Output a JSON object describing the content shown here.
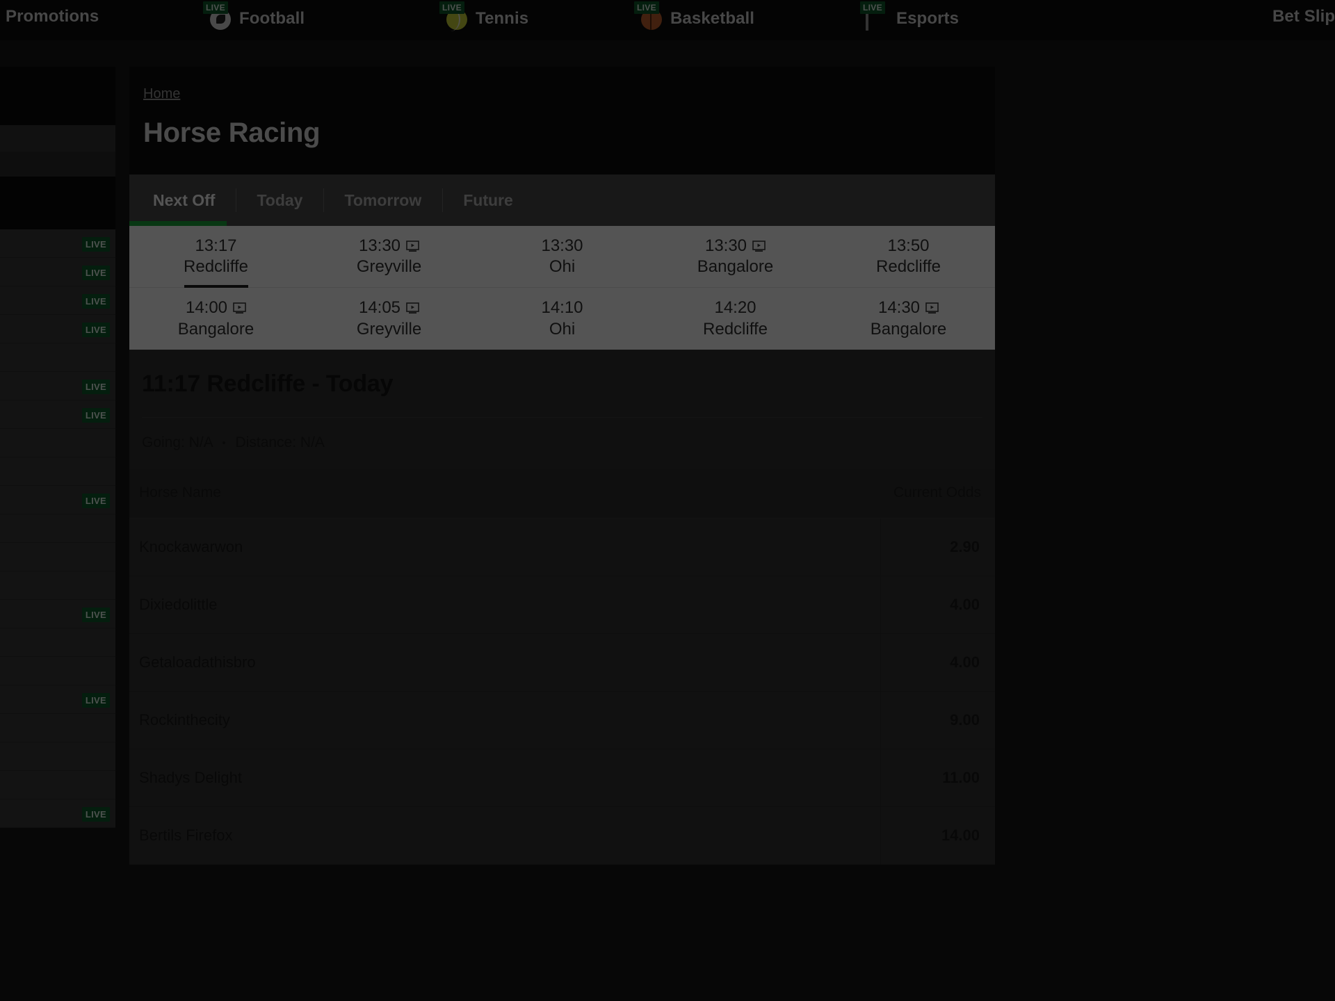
{
  "topnav": {
    "items": [
      {
        "label": "Promotions",
        "icon": "",
        "live": false
      },
      {
        "label": "Football",
        "icon": "football-icon",
        "live": true,
        "live_label": "LIVE"
      },
      {
        "label": "Tennis",
        "icon": "tennis-icon",
        "live": true,
        "live_label": "LIVE"
      },
      {
        "label": "Basketball",
        "icon": "basketball-icon",
        "live": true,
        "live_label": "LIVE"
      },
      {
        "label": "Esports",
        "icon": "esports-icon",
        "live": true,
        "live_label": "LIVE"
      },
      {
        "label": "Bet Slip",
        "icon": "",
        "live": false
      }
    ]
  },
  "sidebar": {
    "live_label": "LIVE",
    "rows": [
      {
        "live": true
      },
      {
        "live": true
      },
      {
        "live": true
      },
      {
        "live": true
      },
      {
        "live": false
      },
      {
        "live": true
      },
      {
        "live": true
      },
      {
        "live": false
      },
      {
        "live": false
      },
      {
        "live": true
      },
      {
        "live": false
      },
      {
        "live": false
      },
      {
        "live": false
      },
      {
        "live": true
      },
      {
        "live": false
      },
      {
        "live": false
      },
      {
        "live": true
      },
      {
        "live": false
      },
      {
        "live": false
      },
      {
        "live": false
      },
      {
        "live": true
      }
    ]
  },
  "header": {
    "breadcrumb": "Home",
    "title": "Horse Racing"
  },
  "tabs": {
    "items": [
      {
        "label": "Next Off",
        "active": true
      },
      {
        "label": "Today",
        "active": false
      },
      {
        "label": "Tomorrow",
        "active": false
      },
      {
        "label": "Future",
        "active": false
      }
    ]
  },
  "races": {
    "rows": [
      [
        {
          "time": "13:17",
          "venue": "Redcliffe",
          "stream": false,
          "selected": true
        },
        {
          "time": "13:30",
          "venue": "Greyville",
          "stream": true,
          "selected": false
        },
        {
          "time": "13:30",
          "venue": "Ohi",
          "stream": false,
          "selected": false
        },
        {
          "time": "13:30",
          "venue": "Bangalore",
          "stream": true,
          "selected": false
        },
        {
          "time": "13:50",
          "venue": "Redcliffe",
          "stream": false,
          "selected": false
        }
      ],
      [
        {
          "time": "14:00",
          "venue": "Bangalore",
          "stream": true,
          "selected": false
        },
        {
          "time": "14:05",
          "venue": "Greyville",
          "stream": true,
          "selected": false
        },
        {
          "time": "14:10",
          "venue": "Ohi",
          "stream": false,
          "selected": false
        },
        {
          "time": "14:20",
          "venue": "Redcliffe",
          "stream": false,
          "selected": false
        },
        {
          "time": "14:30",
          "venue": "Bangalore",
          "stream": true,
          "selected": false
        }
      ]
    ]
  },
  "race_detail": {
    "title": "11:17 Redcliffe - Today",
    "going_label": "Going:",
    "going_value": "N/A",
    "separator": "•",
    "distance_label": "Distance:",
    "distance_value": "N/A"
  },
  "runners_table": {
    "columns": {
      "name": "Horse Name",
      "odds": "Current Odds"
    },
    "rows": [
      {
        "name": "Knockawarwon",
        "odds": "2.90"
      },
      {
        "name": "Dixiedolittle",
        "odds": "4.00"
      },
      {
        "name": "Getaloadathisbro",
        "odds": "4.00"
      },
      {
        "name": "Rockinthecity",
        "odds": "9.00"
      },
      {
        "name": "Shadys Delight",
        "odds": "11.00"
      },
      {
        "name": "Bertils Firefox",
        "odds": "14.00"
      }
    ]
  },
  "colors": {
    "accent_green": "#18a83a",
    "live_green": "#0c5c2a",
    "page_dark": "#0d0d0d",
    "tab_bar": "#4a4a4a",
    "strip_white": "#ffffff"
  }
}
